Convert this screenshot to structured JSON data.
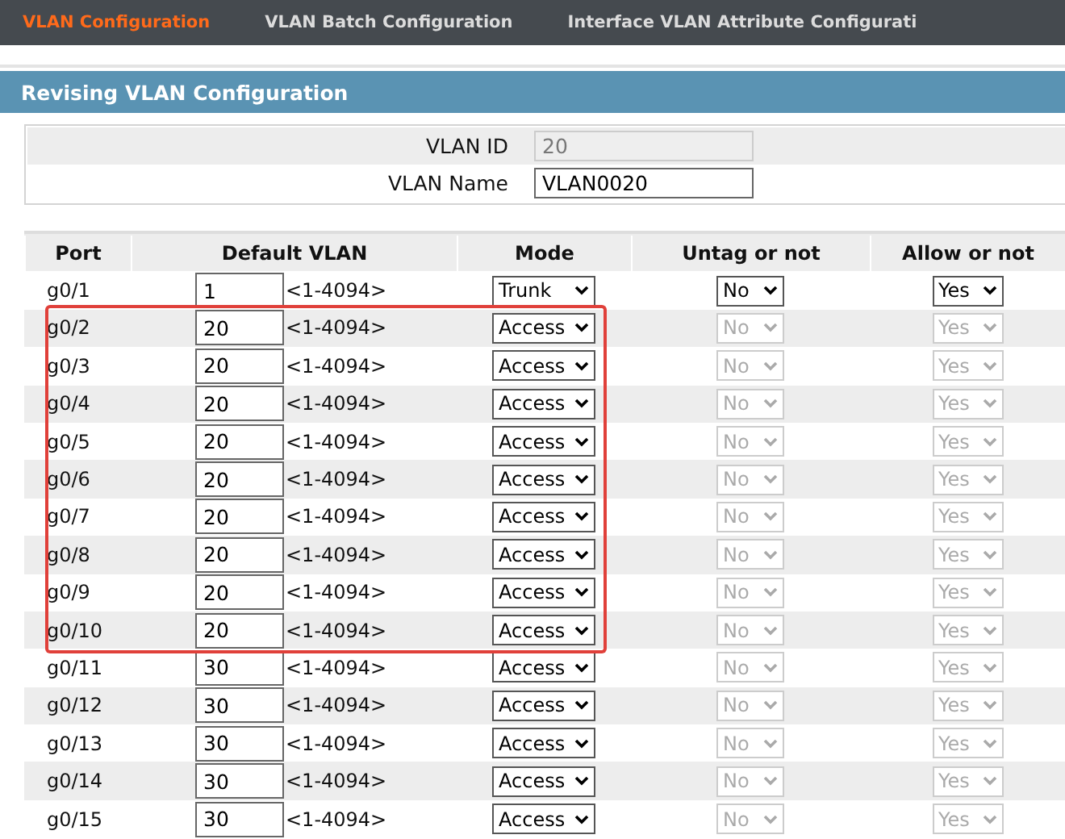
{
  "tabs": [
    {
      "label": "VLAN Configuration",
      "selected": true
    },
    {
      "label": "VLAN Batch Configuration",
      "selected": false
    },
    {
      "label": "Interface VLAN Attribute Configurati",
      "selected": false
    }
  ],
  "section_title": "Revising VLAN Configuration",
  "form": [
    {
      "label": "VLAN ID",
      "value": "20",
      "disabled": true
    },
    {
      "label": "VLAN Name",
      "value": "VLAN0020",
      "disabled": false
    }
  ],
  "table": {
    "columns": [
      "Port",
      "Default VLAN",
      "Mode",
      "Untag or not",
      "Allow or not"
    ],
    "rows": [
      {
        "port": "g0/1",
        "vlan": "1",
        "range": "<1-4094>",
        "mode": "Trunk",
        "untag": "No",
        "allow": "Yes",
        "disabled": false,
        "highlighted": false
      },
      {
        "port": "g0/2",
        "vlan": "20",
        "range": "<1-4094>",
        "mode": "Access",
        "untag": "No",
        "allow": "Yes",
        "disabled": true,
        "highlighted": true
      },
      {
        "port": "g0/3",
        "vlan": "20",
        "range": "<1-4094>",
        "mode": "Access",
        "untag": "No",
        "allow": "Yes",
        "disabled": true,
        "highlighted": true
      },
      {
        "port": "g0/4",
        "vlan": "20",
        "range": "<1-4094>",
        "mode": "Access",
        "untag": "No",
        "allow": "Yes",
        "disabled": true,
        "highlighted": true
      },
      {
        "port": "g0/5",
        "vlan": "20",
        "range": "<1-4094>",
        "mode": "Access",
        "untag": "No",
        "allow": "Yes",
        "disabled": true,
        "highlighted": true
      },
      {
        "port": "g0/6",
        "vlan": "20",
        "range": "<1-4094>",
        "mode": "Access",
        "untag": "No",
        "allow": "Yes",
        "disabled": true,
        "highlighted": true
      },
      {
        "port": "g0/7",
        "vlan": "20",
        "range": "<1-4094>",
        "mode": "Access",
        "untag": "No",
        "allow": "Yes",
        "disabled": true,
        "highlighted": true
      },
      {
        "port": "g0/8",
        "vlan": "20",
        "range": "<1-4094>",
        "mode": "Access",
        "untag": "No",
        "allow": "Yes",
        "disabled": true,
        "highlighted": true
      },
      {
        "port": "g0/9",
        "vlan": "20",
        "range": "<1-4094>",
        "mode": "Access",
        "untag": "No",
        "allow": "Yes",
        "disabled": true,
        "highlighted": true
      },
      {
        "port": "g0/10",
        "vlan": "20",
        "range": "<1-4094>",
        "mode": "Access",
        "untag": "No",
        "allow": "Yes",
        "disabled": true,
        "highlighted": true
      },
      {
        "port": "g0/11",
        "vlan": "30",
        "range": "<1-4094>",
        "mode": "Access",
        "untag": "No",
        "allow": "Yes",
        "disabled": true,
        "highlighted": false
      },
      {
        "port": "g0/12",
        "vlan": "30",
        "range": "<1-4094>",
        "mode": "Access",
        "untag": "No",
        "allow": "Yes",
        "disabled": true,
        "highlighted": false
      },
      {
        "port": "g0/13",
        "vlan": "30",
        "range": "<1-4094>",
        "mode": "Access",
        "untag": "No",
        "allow": "Yes",
        "disabled": true,
        "highlighted": false
      },
      {
        "port": "g0/14",
        "vlan": "30",
        "range": "<1-4094>",
        "mode": "Access",
        "untag": "No",
        "allow": "Yes",
        "disabled": true,
        "highlighted": false
      },
      {
        "port": "g0/15",
        "vlan": "30",
        "range": "<1-4094>",
        "mode": "Access",
        "untag": "No",
        "allow": "Yes",
        "disabled": true,
        "highlighted": false
      }
    ]
  }
}
